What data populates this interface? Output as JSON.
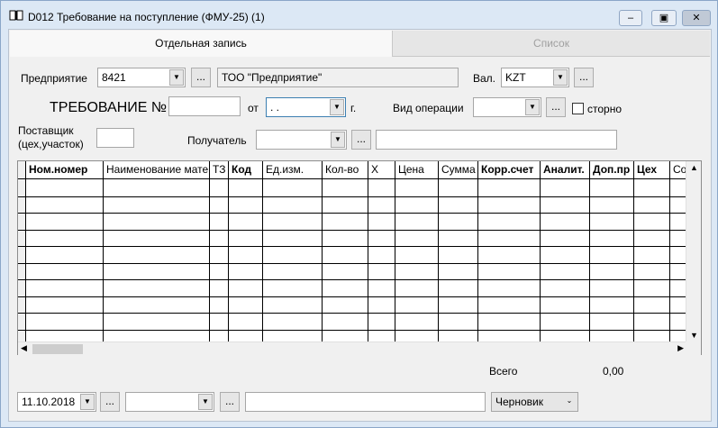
{
  "window": {
    "title": "D012 Требование на поступление (ФМУ-25) (1)",
    "icon": "book-icon"
  },
  "tabs": [
    {
      "label": "Отдельная запись",
      "active": true
    },
    {
      "label": "Список",
      "active": false
    }
  ],
  "form": {
    "enterprise_label": "Предприятие",
    "enterprise_code": "8421",
    "enterprise_name": "ТОО \"Предприятие\"",
    "currency_label": "Вал.",
    "currency": "KZT",
    "requirement_label": "ТРЕБОВАНИЕ №",
    "requirement_number": "",
    "from_label": "от",
    "date_value": " .  .",
    "year_suffix": "г.",
    "operation_label": "Вид операции",
    "operation_value": "",
    "storno_label": "сторно",
    "supplier_label_line1": "Поставщик",
    "supplier_label_line2": "(цех,участок)",
    "supplier_value": "",
    "recipient_label": "Получатель",
    "recipient_value": "",
    "recipient_name": ""
  },
  "table": {
    "columns": [
      "Ном.номер",
      "Наименование мате",
      "ТЗ",
      "Код",
      "Ед.изм.",
      "Кол-во",
      "Х",
      "Цена",
      "Сумма",
      "Корр.счет",
      "Аналит.",
      "Доп.пр",
      "Цех",
      "Сор"
    ],
    "bold_columns": [
      0,
      3,
      9,
      10,
      11,
      12
    ],
    "rows": 10
  },
  "totals": {
    "label": "Всего",
    "value": "0,00"
  },
  "footer": {
    "date": "11.10.2018",
    "combo2": "",
    "text": "",
    "status": "Черновик"
  }
}
